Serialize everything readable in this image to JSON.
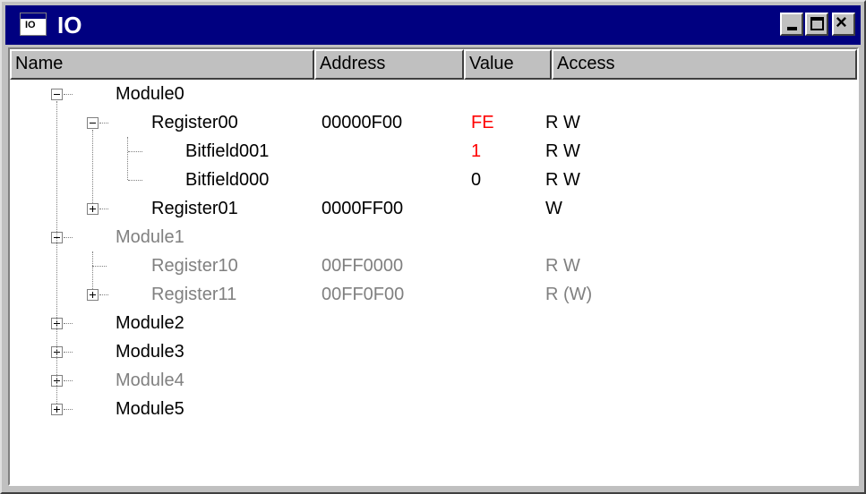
{
  "window": {
    "title": "IO",
    "icon": "io-window-icon"
  },
  "caption_buttons": {
    "minimize": "minimize-icon",
    "maximize": "maximize-icon",
    "close": "close-icon"
  },
  "columns": [
    "Name",
    "Address",
    "Value",
    "Access"
  ],
  "rows": [
    {
      "name": "Module0",
      "address": "",
      "value": "",
      "access": "",
      "level": 0,
      "expander": "minus",
      "state": "normal"
    },
    {
      "name": "Register00",
      "address": "00000F00",
      "value": "FE",
      "access": "R W",
      "level": 1,
      "expander": "minus",
      "state": "normal",
      "value_color": "#ff0000"
    },
    {
      "name": "Bitfield001",
      "address": "",
      "value": "1",
      "access": "R W",
      "level": 2,
      "expander": "none",
      "state": "normal",
      "value_color": "#ff0000"
    },
    {
      "name": "Bitfield000",
      "address": "",
      "value": "0",
      "access": "R W",
      "level": 2,
      "expander": "none",
      "state": "normal"
    },
    {
      "name": "Register01",
      "address": "0000FF00",
      "value": "",
      "access": "W",
      "level": 1,
      "expander": "plus",
      "state": "normal"
    },
    {
      "name": "Module1",
      "address": "",
      "value": "",
      "access": "",
      "level": 0,
      "expander": "minus",
      "state": "disabled"
    },
    {
      "name": "Register10",
      "address": "00FF0000",
      "value": "",
      "access": "R W",
      "level": 1,
      "expander": "none",
      "state": "disabled"
    },
    {
      "name": "Register11",
      "address": "00FF0F00",
      "value": "",
      "access": "R (W)",
      "level": 1,
      "expander": "plus",
      "state": "disabled"
    },
    {
      "name": "Module2",
      "address": "",
      "value": "",
      "access": "",
      "level": 0,
      "expander": "plus",
      "state": "normal"
    },
    {
      "name": "Module3",
      "address": "",
      "value": "",
      "access": "",
      "level": 0,
      "expander": "plus",
      "state": "normal"
    },
    {
      "name": "Module4",
      "address": "",
      "value": "",
      "access": "",
      "level": 0,
      "expander": "plus",
      "state": "disabled"
    },
    {
      "name": "Module5",
      "address": "",
      "value": "",
      "access": "",
      "level": 0,
      "expander": "plus",
      "state": "normal"
    }
  ],
  "colors": {
    "titlebar": "#000080",
    "highlight_value": "#ff0000",
    "disabled_text": "#808080",
    "face": "#c0c0c0"
  }
}
